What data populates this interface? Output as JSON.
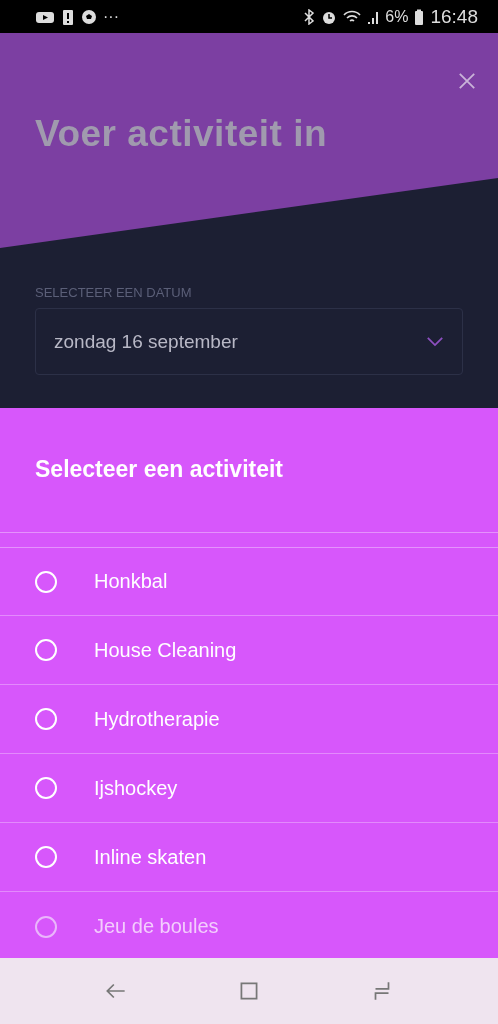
{
  "status_bar": {
    "battery": "6%",
    "time": "16:48",
    "overflow": "···"
  },
  "header": {
    "title": "Voer activiteit in"
  },
  "date": {
    "label": "SELECTEER EEN DATUM",
    "value": "zondag 16 september"
  },
  "sheet": {
    "title": "Selecteer een activiteit",
    "items": [
      {
        "label": "Honkbal",
        "selected": false,
        "dimmed": false
      },
      {
        "label": "House Cleaning",
        "selected": false,
        "dimmed": false
      },
      {
        "label": "Hydrotherapie",
        "selected": false,
        "dimmed": false
      },
      {
        "label": "Ijshockey",
        "selected": false,
        "dimmed": false
      },
      {
        "label": "Inline skaten",
        "selected": false,
        "dimmed": false
      },
      {
        "label": "Jeu de boules",
        "selected": false,
        "dimmed": true
      }
    ]
  }
}
